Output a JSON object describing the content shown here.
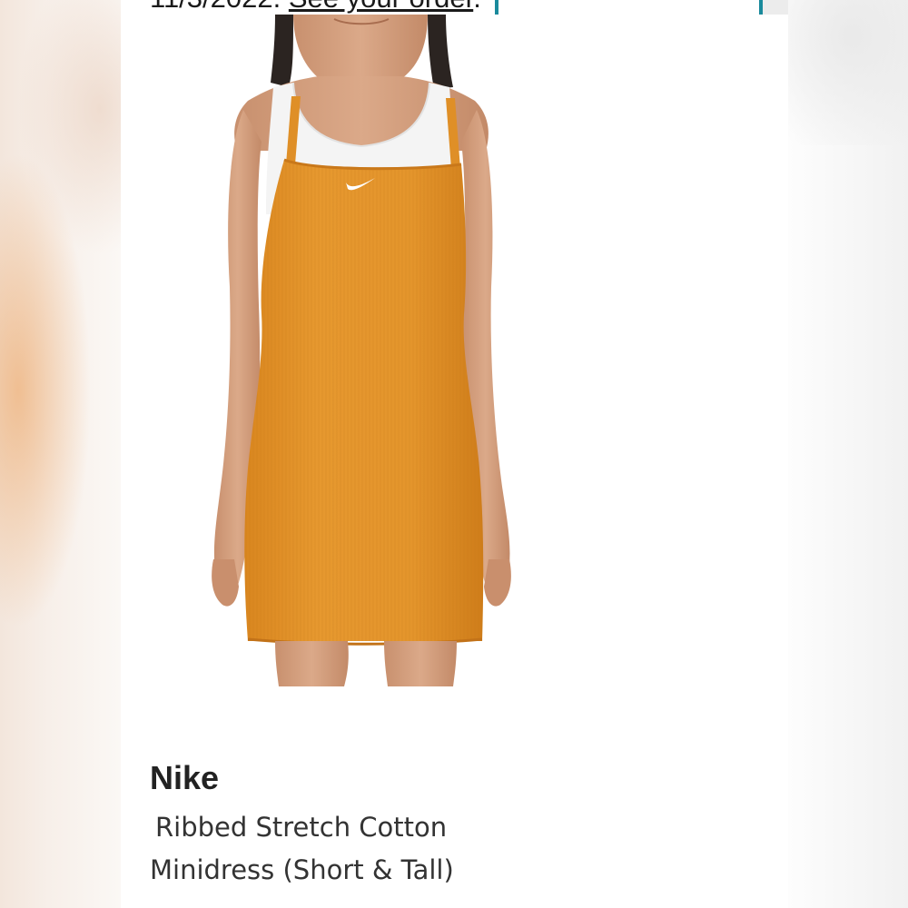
{
  "notice": {
    "date_text": "11/3/2022.",
    "link_text": "See your order",
    "trailing": "."
  },
  "product": {
    "brand": "Nike",
    "name_line1": "Ribbed Stretch Cotton",
    "name_line2": "Minidress (Short & Tall)",
    "color": "#e3932a",
    "logo": "swoosh-icon"
  },
  "colors": {
    "accent": "#1a8a9c",
    "dress": "#e3932a",
    "text": "#222222"
  }
}
